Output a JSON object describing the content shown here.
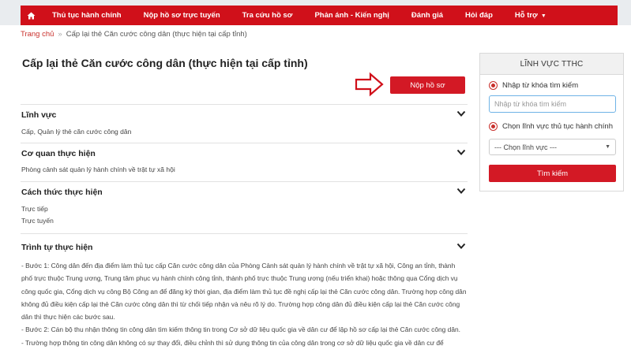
{
  "nav": {
    "home_icon": "home-icon",
    "items": [
      {
        "label": "Thủ tục hành chính"
      },
      {
        "label": "Nộp hồ sơ trực tuyến"
      },
      {
        "label": "Tra cứu hồ sơ"
      },
      {
        "label": "Phản ánh - Kiến nghị"
      },
      {
        "label": "Đánh giá"
      },
      {
        "label": "Hỏi đáp"
      },
      {
        "label": "Hỗ trợ"
      }
    ]
  },
  "breadcrumb": {
    "home": "Trang chủ",
    "separator": "»",
    "current": "Cấp lại thẻ Căn cước công dân (thực hiện tại cấp tỉnh)"
  },
  "page_title": "Cấp lại thẻ Căn cước công dân (thực hiện tại cấp tỉnh)",
  "submit_label": "Nộp hồ sơ",
  "sections": {
    "linh_vuc": {
      "title": "Lĩnh vực",
      "text": "Cấp, Quản lý thẻ căn cước công dân"
    },
    "co_quan": {
      "title": "Cơ quan thực hiện",
      "text": "Phòng cảnh sát quản lý hành chính về trật tự xã hội"
    },
    "cach_thuc": {
      "title": "Cách thức thực hiện",
      "items": [
        "Trực tiếp",
        "Trực tuyến"
      ]
    },
    "trinh_tu": {
      "title": "Trình tự thực hiện",
      "paragraphs": [
        "- Bước 1: Công dân đến địa điểm làm thủ tục cấp Căn cước công dân của Phòng Cảnh sát quản lý hành chính về trật tự xã hội, Công an tỉnh, thành phố trực thuộc Trung ương, Trung tâm phục vụ hành chính công tỉnh, thành phố trực thuộc Trung ương (nếu triển khai) hoặc thông qua Cổng dịch vụ công quốc gia, Cổng dịch vụ công Bộ Công an để đăng ký thời gian, địa điểm làm thủ tục đề nghị cấp lại thẻ Căn cước công dân. Trường hợp công dân không đủ điều kiện cấp lại thẻ Căn cước công dân thì từ chối tiếp nhận và nêu rõ lý do. Trường hợp công dân đủ điều kiện cấp lại thẻ Căn cước công dân thì thực hiện các bước sau.",
        "- Bước 2: Cán bộ thu nhận thông tin công dân tìm kiếm thông tin trong Cơ sở dữ liệu quốc gia về dân cư để lập hồ sơ cấp lại thẻ Căn cước công dân.",
        "- Trường hợp thông tin công dân không có sự thay đổi, điều chỉnh thì sử dụng thông tin của công dân trong cơ sở dữ liệu quốc gia về dân cư để"
      ]
    }
  },
  "sidebar": {
    "header": "LĨNH VỰC TTHC",
    "radio_keyword": "Nhập từ khóa tìm kiếm",
    "keyword_placeholder": "Nhập từ khóa tìm kiếm",
    "radio_field": "Chọn lĩnh vực thủ tục hành chính",
    "select_value": "--- Chọn lĩnh vực ---",
    "search_button": "Tìm kiếm"
  },
  "colors": {
    "brand_red": "#d0101a",
    "button_red": "#d31925",
    "link_red": "#c9302c"
  }
}
